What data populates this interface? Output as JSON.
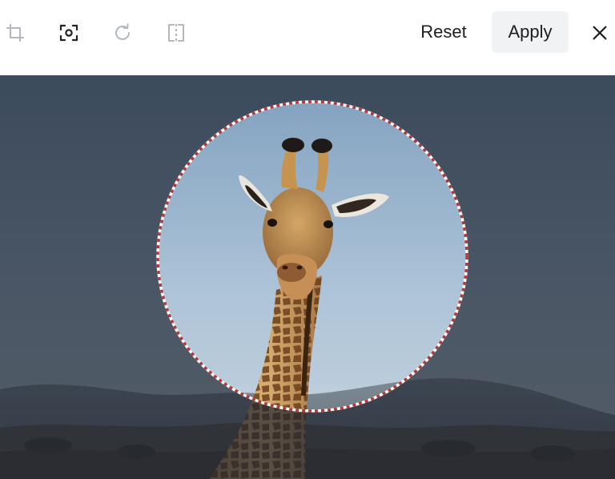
{
  "toolbar": {
    "tools": [
      {
        "icon": "crop-icon",
        "state": "inactive"
      },
      {
        "icon": "focus-frame-icon",
        "state": "active"
      },
      {
        "icon": "rotate-icon",
        "state": "inactive"
      },
      {
        "icon": "flip-icon",
        "state": "inactive"
      }
    ],
    "reset_label": "Reset",
    "apply_label": "Apply",
    "close_icon": "close-icon"
  },
  "colors": {
    "active_icon": "#222222",
    "inactive_icon": "#b3b6ba",
    "apply_bg": "#f0f2f4",
    "selection_dash": "#b23a3a",
    "dim_overlay": "#1d2430"
  },
  "editor": {
    "selection_shape": "circle",
    "image_subject": "giraffe"
  }
}
